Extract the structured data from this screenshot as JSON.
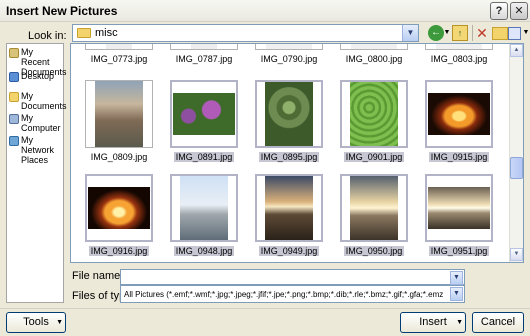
{
  "window": {
    "title": "Insert New Pictures",
    "help_glyph": "?",
    "close_glyph": "✕"
  },
  "lookin": {
    "label": "Look in:",
    "value": "misc"
  },
  "toolbar": {
    "icons": [
      "back-icon",
      "up-folder-icon",
      "delete-icon",
      "new-folder-icon",
      "views-icon"
    ]
  },
  "places": [
    {
      "label": "My Recent Documents"
    },
    {
      "label": "Desktop"
    },
    {
      "label": "My Documents"
    },
    {
      "label": "My Computer"
    },
    {
      "label": "My Network Places"
    }
  ],
  "files": {
    "row1": [
      {
        "name": "IMG_0773.jpg",
        "selected": false
      },
      {
        "name": "IMG_0787.jpg",
        "selected": false
      },
      {
        "name": "IMG_0790.jpg",
        "selected": false
      },
      {
        "name": "IMG_0800.jpg",
        "selected": false
      },
      {
        "name": "IMG_0803.jpg",
        "selected": false
      }
    ],
    "row2": [
      {
        "name": "IMG_0809.jpg",
        "selected": false
      },
      {
        "name": "IMG_0891.jpg",
        "selected": true
      },
      {
        "name": "IMG_0895.jpg",
        "selected": true
      },
      {
        "name": "IMG_0901.jpg",
        "selected": true
      },
      {
        "name": "IMG_0915.jpg",
        "selected": true
      }
    ],
    "row3": [
      {
        "name": "IMG_0916.jpg",
        "selected": true
      },
      {
        "name": "IMG_0948.jpg",
        "selected": true
      },
      {
        "name": "IMG_0949.jpg",
        "selected": true
      },
      {
        "name": "IMG_0950.jpg",
        "selected": true
      },
      {
        "name": "IMG_0951.jpg",
        "selected": true
      }
    ]
  },
  "filename": {
    "label": "File name:",
    "value": ""
  },
  "filetype": {
    "label": "Files of type:",
    "value": "All Pictures (*.emf;*.wmf;*.jpg;*.jpeg;*.jfif;*.jpe;*.png;*.bmp;*.dib;*.rle;*.bmz;*.gif;*.gfa;*.emz"
  },
  "buttons": {
    "tools": "Tools",
    "insert": "Insert",
    "cancel": "Cancel"
  }
}
